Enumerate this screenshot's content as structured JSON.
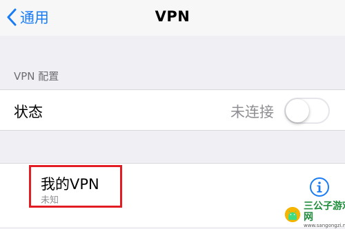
{
  "nav": {
    "back_label": "通用",
    "title": "VPN"
  },
  "section": {
    "header": "VPN 配置"
  },
  "status_row": {
    "label": "状态",
    "value": "未连接",
    "toggle_on": false
  },
  "vpn_row": {
    "name": "我的VPN",
    "subtitle": "未知",
    "highlight_color": "#e31c23"
  },
  "watermark": {
    "text": "三公子游戏网",
    "url": "www.sangongzi.net"
  },
  "colors": {
    "accent": "#1a7cf5",
    "background": "#efeff4",
    "secondary_text": "#8e8e93"
  },
  "icons": {
    "back": "chevron-left-icon",
    "info": "info-circle-icon"
  }
}
